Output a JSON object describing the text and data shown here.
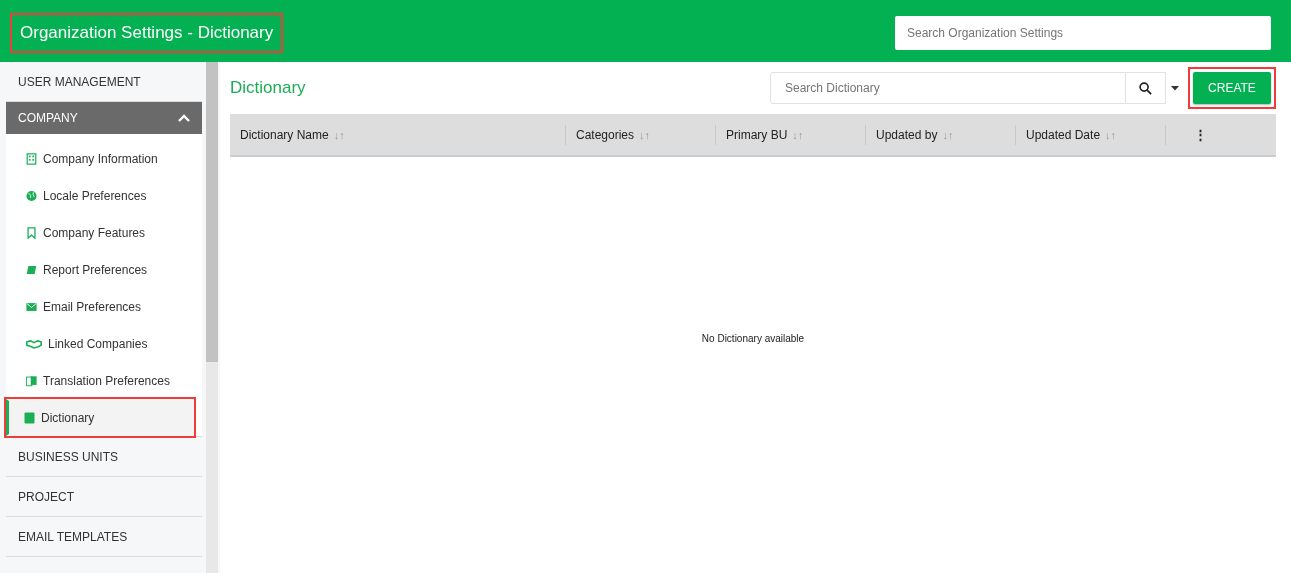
{
  "header": {
    "title": "Organization Settings - Dictionary",
    "title_highlighted": true,
    "search": {
      "placeholder": "Search Organization Settings"
    }
  },
  "sidebar": {
    "sections": [
      {
        "label": "USER MANAGEMENT",
        "selected": false
      },
      {
        "label": "COMPANY",
        "expanded": true,
        "selected": true,
        "items": [
          {
            "label": "Company Information",
            "selected": false,
            "highlighted": false
          },
          {
            "label": "Locale Preferences",
            "selected": false,
            "highlighted": false
          },
          {
            "label": "Company Features",
            "selected": false,
            "highlighted": false
          },
          {
            "label": "Report Preferences",
            "selected": false,
            "highlighted": false
          },
          {
            "label": "Email Preferences",
            "selected": false,
            "highlighted": false
          },
          {
            "label": "Linked Companies",
            "selected": false,
            "highlighted": false
          },
          {
            "label": "Translation Preferences",
            "selected": false,
            "highlighted": false
          },
          {
            "label": "Dictionary",
            "selected": true,
            "highlighted": true
          }
        ]
      },
      {
        "label": "BUSINESS UNITS",
        "selected": false
      },
      {
        "label": "PROJECT",
        "selected": false
      },
      {
        "label": "EMAIL TEMPLATES",
        "selected": false
      }
    ]
  },
  "main": {
    "title": "Dictionary",
    "search": {
      "placeholder": "Search Dictionary"
    },
    "create_button": {
      "label": "CREATE",
      "highlighted": true
    },
    "table": {
      "columns": [
        {
          "label": "Dictionary Name",
          "sort": "↓↑"
        },
        {
          "label": "Categories",
          "sort": "↓↑"
        },
        {
          "label": "Primary BU",
          "sort": "↓↑"
        },
        {
          "label": "Updated by",
          "sort": "↓↑"
        },
        {
          "label": "Updated Date",
          "sort": "↓↑"
        }
      ],
      "menu": "⋮",
      "empty_message": "No Dictionary available"
    }
  }
}
